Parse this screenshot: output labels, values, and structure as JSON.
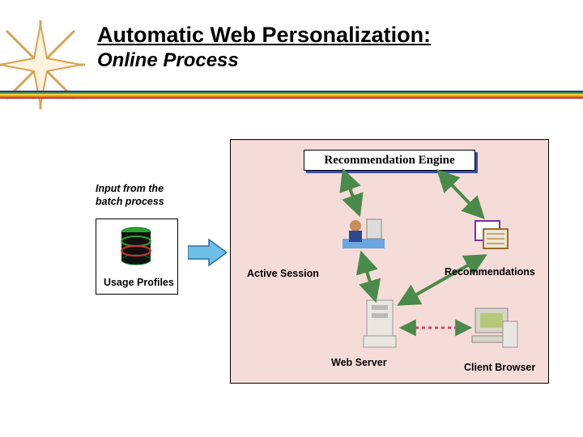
{
  "title": "Automatic Web Personalization:",
  "subtitle": "Online Process",
  "input_label_l1": "Input from the",
  "input_label_l2": "batch process",
  "usage_profiles": "Usage Profiles",
  "main": {
    "rec_engine": "Recommendation Engine",
    "active_session": "Active Session",
    "recommendations": "Recommendations",
    "web_server": "Web Server",
    "client_browser": "Client Browser"
  }
}
